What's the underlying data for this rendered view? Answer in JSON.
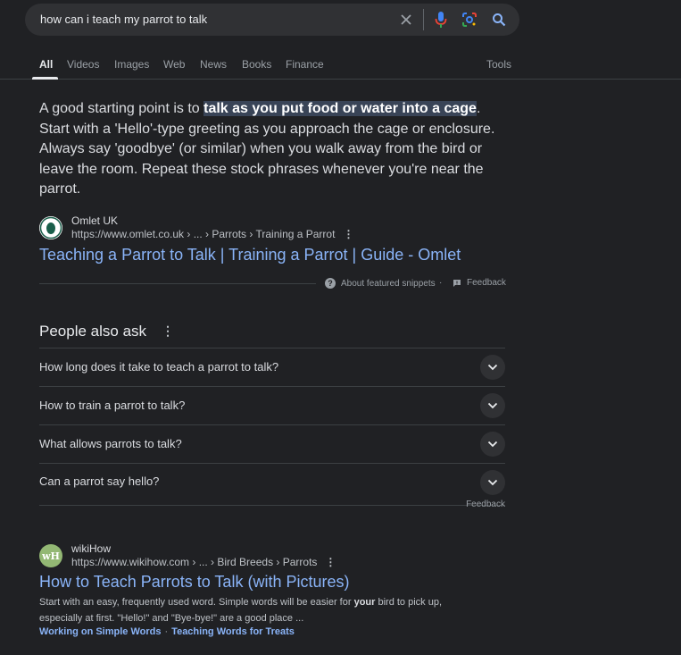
{
  "search": {
    "query": "how can i teach my parrot to talk"
  },
  "tabs": [
    {
      "label": "All"
    },
    {
      "label": "Videos"
    },
    {
      "label": "Images"
    },
    {
      "label": "Web"
    },
    {
      "label": "News"
    },
    {
      "label": "Books"
    },
    {
      "label": "Finance"
    }
  ],
  "tools_label": "Tools",
  "featured_snippet": {
    "text_before": "A good starting point is to ",
    "highlight": "talk as you put food or water into a cage",
    "text_after": ". Start with a 'Hello'-type greeting as you approach the cage or enclosure. Always say 'goodbye' (or similar) when you walk away from the bird or leave the room. Repeat these stock phrases whenever you're near the parrot.",
    "source_name": "Omlet UK",
    "source_url": "https://www.omlet.co.uk › ... › Parrots › Training a Parrot",
    "title": "Teaching a Parrot to Talk | Training a Parrot | Guide - Omlet",
    "about_label": "About featured snippets",
    "feedback_label": "Feedback"
  },
  "paa": {
    "title": "People also ask",
    "questions": [
      "How long does it take to teach a parrot to talk?",
      "How to train a parrot to talk?",
      "What allows parrots to talk?",
      "Can a parrot say hello?"
    ],
    "feedback_label": "Feedback"
  },
  "result_wikihow": {
    "logo_text": "wH",
    "source_name": "wikiHow",
    "source_url": "https://www.wikihow.com › ... › Bird Breeds › Parrots",
    "title": "How to Teach Parrots to Talk (with Pictures)",
    "desc_part1": "Start with an easy, frequently used word. Simple words will be easier for ",
    "desc_bold": "your",
    "desc_part2": " bird to pick up, especially at first. \"Hello!\" and \"Bye-bye!\" are a good place ...",
    "sitelinks": [
      "Working on Simple Words",
      "Teaching Words for Treats"
    ]
  },
  "colors": {
    "background": "#202124",
    "link": "#8ab4f8",
    "highlight": "#394457",
    "mic_blue": "#4285f4",
    "mic_red": "#ea4335"
  }
}
